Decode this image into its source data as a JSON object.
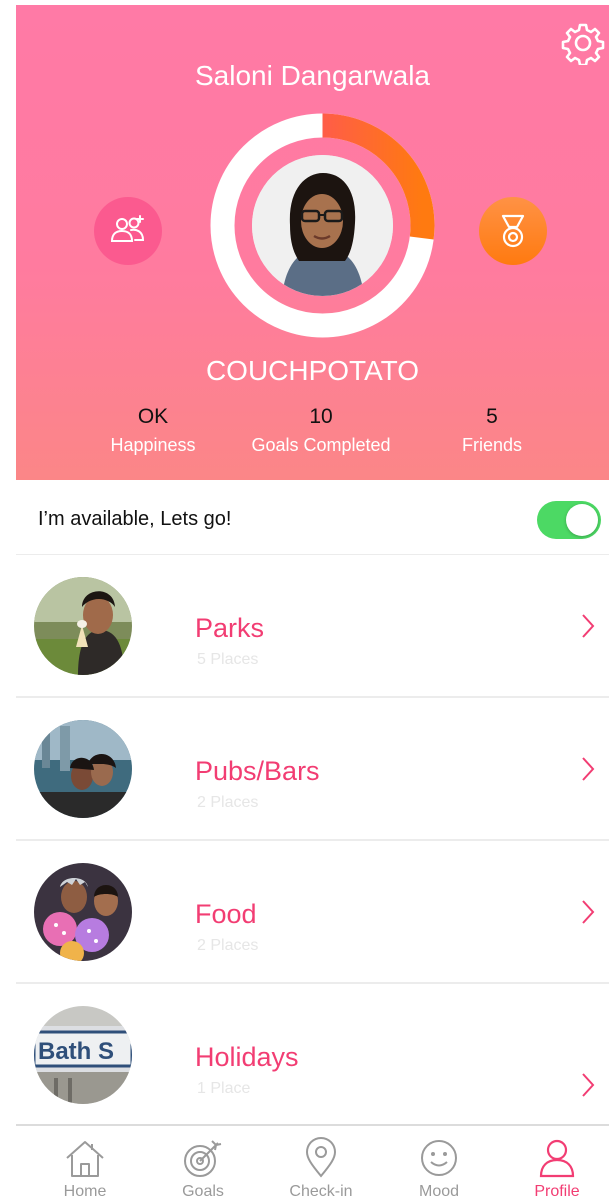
{
  "profile": {
    "name": "Saloni Dangarwala",
    "level": "COUCHPOTATO",
    "progress": 0.27
  },
  "stats": [
    {
      "value": "OK",
      "label": "Happiness"
    },
    {
      "value": "10",
      "label": "Goals Completed"
    },
    {
      "value": "5",
      "label": "Friends"
    }
  ],
  "availability": {
    "label": "I’m available, Lets go!",
    "enabled": true
  },
  "categories": [
    {
      "title": "Parks",
      "subtitle": "5 Places"
    },
    {
      "title": "Pubs/Bars",
      "subtitle": "2 Places"
    },
    {
      "title": "Food",
      "subtitle": "2 Places"
    },
    {
      "title": "Holidays",
      "subtitle": "1 Place",
      "photo_text": "Bath S"
    }
  ],
  "tabs": [
    {
      "label": "Home",
      "icon": "home-icon"
    },
    {
      "label": "Goals",
      "icon": "target-icon"
    },
    {
      "label": "Check-in",
      "icon": "location-pin-icon"
    },
    {
      "label": "Mood",
      "icon": "smiley-icon"
    },
    {
      "label": "Profile",
      "icon": "person-icon",
      "active": true
    }
  ],
  "colors": {
    "accent": "#f23d73",
    "header_top": "#ff7aa6",
    "header_bottom": "#fb8687",
    "progress_start": "#ff3f80",
    "progress_end": "#ff7a10",
    "toggle_on": "#4cd964",
    "tab_inactive": "#9a9a9a"
  }
}
